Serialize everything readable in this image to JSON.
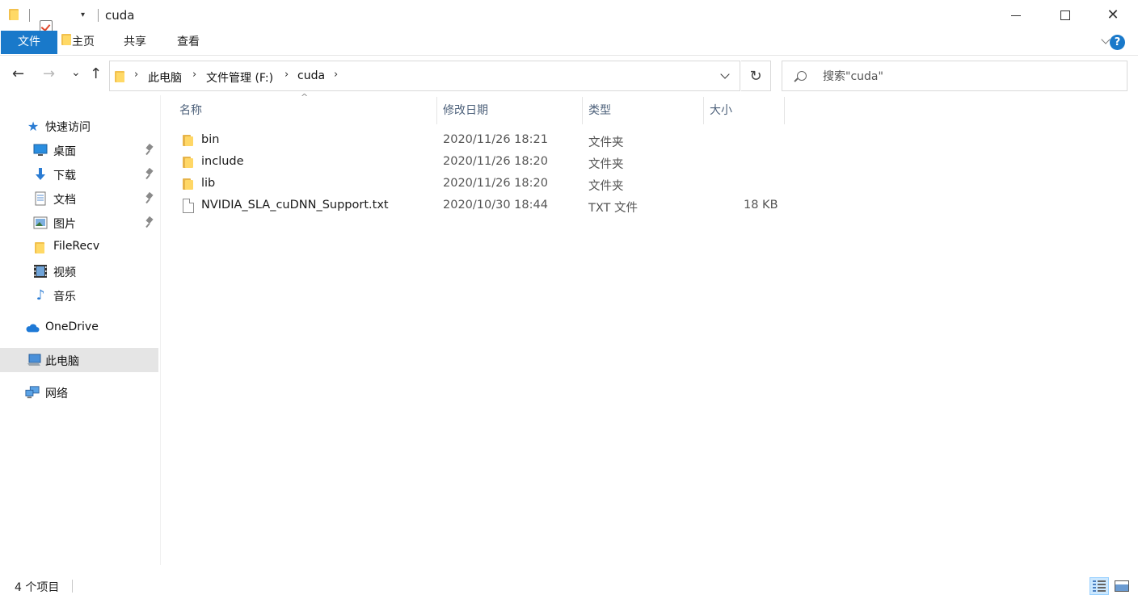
{
  "window": {
    "title": "cuda",
    "controls": {
      "minimize": "—",
      "maximize": "☐",
      "close": "✕"
    }
  },
  "quick_access_toolbar": {
    "items": [
      "folder-icon",
      "properties-icon",
      "new-folder-icon",
      "customize-dropdown"
    ],
    "dropdown_glyph": "▾"
  },
  "ribbon": {
    "tabs": [
      {
        "label": "文件",
        "active": true
      },
      {
        "label": "主页"
      },
      {
        "label": "共享"
      },
      {
        "label": "查看"
      }
    ],
    "help_label": "?"
  },
  "navigation": {
    "back": "←",
    "forward": "→",
    "recent": "⌄",
    "up": "↑",
    "refresh": "↻",
    "breadcrumb": [
      "此电脑",
      "文件管理 (F:)",
      "cuda"
    ],
    "separator": "›",
    "search_placeholder": "搜索\"cuda\""
  },
  "sidebar": {
    "items": [
      {
        "label": "快速访问",
        "icon": "star-icon"
      },
      {
        "label": "桌面",
        "icon": "desktop-icon",
        "pinned": true
      },
      {
        "label": "下载",
        "icon": "download-icon",
        "pinned": true
      },
      {
        "label": "文档",
        "icon": "document-icon",
        "pinned": true
      },
      {
        "label": "图片",
        "icon": "pictures-icon",
        "pinned": true
      },
      {
        "label": "FileRecv",
        "icon": "folder-icon"
      },
      {
        "label": "视频",
        "icon": "video-icon"
      },
      {
        "label": "音乐",
        "icon": "music-icon"
      },
      {
        "label": "OneDrive",
        "icon": "cloud-icon"
      },
      {
        "label": "此电脑",
        "icon": "computer-icon",
        "selected": true
      },
      {
        "label": "网络",
        "icon": "network-icon"
      }
    ]
  },
  "file_list": {
    "columns": [
      {
        "label": "名称"
      },
      {
        "label": "修改日期"
      },
      {
        "label": "类型"
      },
      {
        "label": "大小"
      }
    ],
    "sort_glyph": "^",
    "rows": [
      {
        "name": "bin",
        "modified": "2020/11/26 18:21",
        "type": "文件夹",
        "size": "",
        "icon": "folder-icon"
      },
      {
        "name": "include",
        "modified": "2020/11/26 18:20",
        "type": "文件夹",
        "size": "",
        "icon": "folder-icon"
      },
      {
        "name": "lib",
        "modified": "2020/11/26 18:20",
        "type": "文件夹",
        "size": "",
        "icon": "folder-icon"
      },
      {
        "name": "NVIDIA_SLA_cuDNN_Support.txt",
        "modified": "2020/10/30 18:44",
        "type": "TXT 文件",
        "size": "18 KB",
        "icon": "text-file-icon"
      }
    ]
  },
  "status_bar": {
    "item_count": "4 个项目",
    "active_view": "details"
  },
  "colors": {
    "accent": "#1979ca",
    "folder": "#ffd766",
    "selected_nav": "#e5e5e5",
    "column_header_text": "#4c607a"
  }
}
